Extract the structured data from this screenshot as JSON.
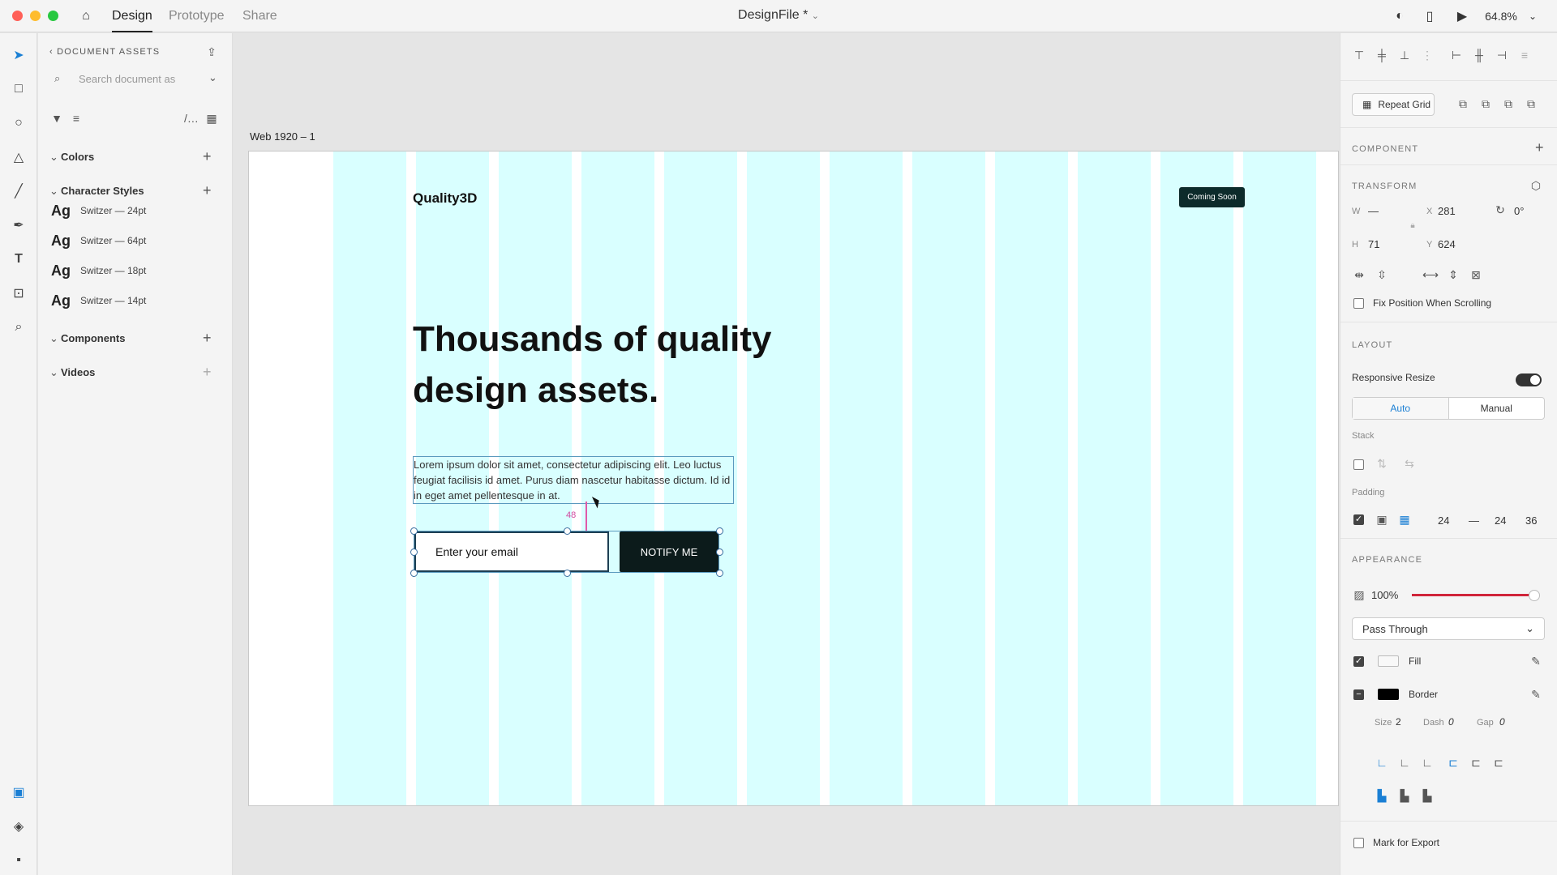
{
  "titlebar": {
    "tabs": [
      "Design",
      "Prototype",
      "Share"
    ],
    "document_title": "DesignFile *",
    "zoom": "64.8%"
  },
  "assets_panel": {
    "header": "DOCUMENT ASSETS",
    "search_placeholder": "Search document as",
    "sections": {
      "colors": "Colors",
      "character_styles": "Character Styles",
      "components": "Components",
      "videos": "Videos"
    },
    "character_styles": [
      {
        "sample": "Ag",
        "name": "Switzer — 24pt"
      },
      {
        "sample": "Ag",
        "name": "Switzer — 64pt"
      },
      {
        "sample": "Ag",
        "name": "Switzer — 18pt"
      },
      {
        "sample": "Ag",
        "name": "Switzer — 14pt"
      }
    ]
  },
  "canvas": {
    "artboard_label": "Web 1920 – 1",
    "brand": "Quality3D",
    "badge": "Coming Soon",
    "headline": "Thousands of quality design assets.",
    "body": "Lorem ipsum dolor sit amet, consectetur adipiscing elit. Leo luctus feugiat facilisis id amet. Purus diam nascetur habitasse dictum. Id id in eget amet pellentesque in at.",
    "spacing_value": "48",
    "email_placeholder": "Enter your email",
    "notify_label": "NOTIFY ME",
    "grid_color": "#d9ffff"
  },
  "properties": {
    "repeat_grid": "Repeat Grid",
    "component_label": "COMPONENT",
    "transform_label": "TRANSFORM",
    "w_label": "W",
    "w_value": "—",
    "h_label": "H",
    "h_value": "71",
    "x_label": "X",
    "x_value": "281",
    "y_label": "Y",
    "y_value": "624",
    "rotation": "0°",
    "fix_position": "Fix Position When Scrolling",
    "layout_label": "LAYOUT",
    "responsive_resize": "Responsive Resize",
    "auto": "Auto",
    "manual": "Manual",
    "stack": "Stack",
    "padding": "Padding",
    "padding_values": [
      "24",
      "—",
      "24",
      "36"
    ],
    "appearance_label": "APPEARANCE",
    "opacity": "100%",
    "blend_mode": "Pass Through",
    "fill": "Fill",
    "border": "Border",
    "size_label": "Size",
    "size_value": "2",
    "dash_label": "Dash",
    "dash_value": "0",
    "gap_label": "Gap",
    "gap_value": "0",
    "mark_export": "Mark for Export"
  }
}
